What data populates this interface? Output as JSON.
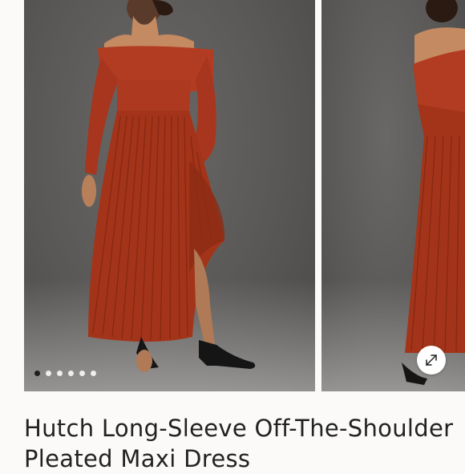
{
  "product": {
    "title": "Hutch Long-Sleeve Off-The-Shoulder Pleated Maxi Dress"
  },
  "gallery": {
    "image_count": 6,
    "active_index": 0,
    "expand_icon": "expand-arrows-icon"
  },
  "colors": {
    "dress": "#a8381f",
    "background": "#5c5a58",
    "page": "#fbfaf8"
  }
}
